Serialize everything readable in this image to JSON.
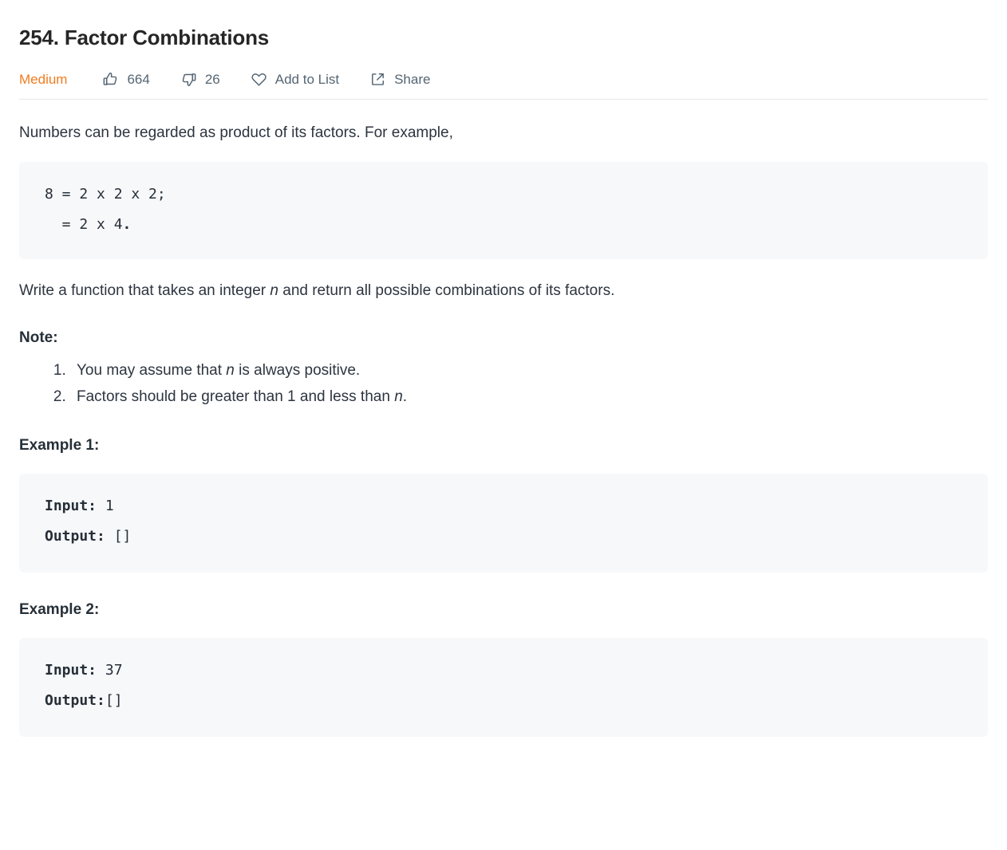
{
  "problem": {
    "title": "254. Factor Combinations",
    "difficulty": "Medium",
    "difficulty_color": "#ef7c1f",
    "likes": "664",
    "dislikes": "26",
    "add_to_list_label": "Add to List",
    "share_label": "Share",
    "icons": {
      "like": "thumbs-up-icon",
      "dislike": "thumbs-down-icon",
      "add_to_list": "heart-icon",
      "share": "share-icon"
    }
  },
  "content": {
    "intro": "Numbers can be regarded as product of its factors. For example,",
    "formula_line1": "8 = 2 x 2 x 2;",
    "formula_line2": "  = 2 x 4",
    "formula_line2_dot": ".",
    "task_before": "Write a function that takes an integer ",
    "task_var": "n",
    "task_after": " and return all possible combinations of its factors.",
    "note_heading": "Note:",
    "notes": [
      {
        "before": "You may assume that ",
        "var": "n",
        "after": " is always positive."
      },
      {
        "before": "Factors should be greater than 1 and less than ",
        "var": "n",
        "after": "."
      }
    ]
  },
  "examples": [
    {
      "heading": "Example 1:",
      "input_label": "Input:",
      "input_value": " 1",
      "output_label": "Output:",
      "output_value": " []"
    },
    {
      "heading": "Example 2:",
      "input_label": "Input:",
      "input_value": " 37",
      "output_label": "Output:",
      "output_value": "[]"
    }
  ],
  "theme": {
    "code_background": "#f7f8fa",
    "divider": "#e8e8e8",
    "text": "#2d3540",
    "meta_text": "#546573"
  }
}
